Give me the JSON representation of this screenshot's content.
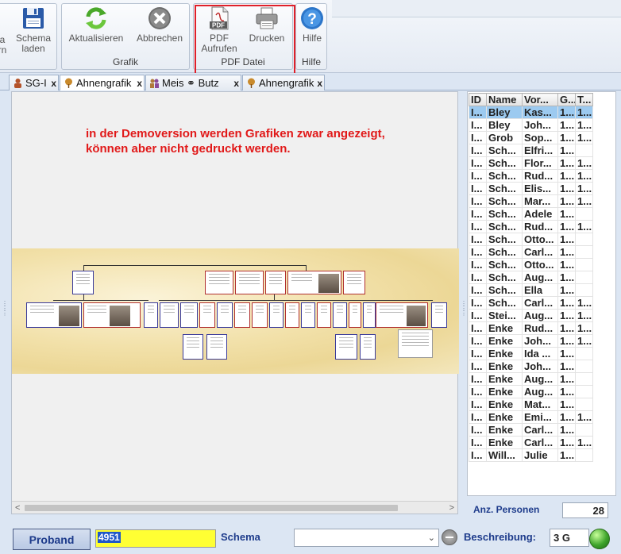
{
  "ribbon": {
    "schema_group": {
      "partial_label_top": "a",
      "partial_label_bottom": "rn",
      "schema_laden_label_1": "Schema",
      "schema_laden_label_2": "laden"
    },
    "grafik_group": {
      "label": "Grafik",
      "aktualisieren_label": "Aktualisieren",
      "abbrechen_label": "Abbrechen"
    },
    "pdf_group": {
      "label": "PDF Datei",
      "pdf_label_1": "PDF",
      "pdf_label_2": "Aufrufen",
      "drucken_label": "Drucken",
      "pdf_icon_text": "PDF"
    },
    "hilfe_group": {
      "label": "Hilfe",
      "hilfe_label": "Hilfe",
      "help_icon_text": "?"
    }
  },
  "tabs": [
    {
      "label": "SG-I",
      "close": "x",
      "icon": "person-icon"
    },
    {
      "label": "Ahnengrafik",
      "close": "x",
      "icon": "tree-icon"
    },
    {
      "label": "Meis ⚭ Butz",
      "close": "x",
      "icon": "couple-icon"
    },
    {
      "label": "Ahnengrafik",
      "close": "x",
      "icon": "tree-icon"
    }
  ],
  "canvas": {
    "demo_note_line1": "in der Demoversion werden Grafiken zwar angezeigt,",
    "demo_note_line2": "können aber nicht gedruckt werden."
  },
  "person_list": {
    "headers": [
      "ID",
      "Name",
      "Vor...",
      "G...",
      "T..."
    ],
    "rows": [
      [
        "I...",
        "Bley",
        "Kas...",
        "1...",
        "1..."
      ],
      [
        "I...",
        "Bley",
        "Joh...",
        "1...",
        "1..."
      ],
      [
        "I...",
        "Grob",
        "Sop...",
        "1...",
        "1..."
      ],
      [
        "I...",
        "Sch...",
        "Elfri...",
        "1...",
        ""
      ],
      [
        "I...",
        "Sch...",
        "Flor...",
        "1...",
        "1..."
      ],
      [
        "I...",
        "Sch...",
        "Rud...",
        "1...",
        "1..."
      ],
      [
        "I...",
        "Sch...",
        "Elis...",
        "1...",
        "1..."
      ],
      [
        "I...",
        "Sch...",
        "Mar...",
        "1...",
        "1..."
      ],
      [
        "I...",
        "Sch...",
        "Adele",
        "1...",
        ""
      ],
      [
        "I...",
        "Sch...",
        "Rud...",
        "1...",
        "1..."
      ],
      [
        "I...",
        "Sch...",
        "Otto...",
        "1...",
        ""
      ],
      [
        "I...",
        "Sch...",
        "Carl...",
        "1...",
        ""
      ],
      [
        "I...",
        "Sch...",
        "Otto...",
        "1...",
        ""
      ],
      [
        "I...",
        "Sch...",
        "Aug...",
        "1...",
        ""
      ],
      [
        "I...",
        "Sch...",
        "Ella",
        "1...",
        ""
      ],
      [
        "I...",
        "Sch...",
        "Carl...",
        "1...",
        "1..."
      ],
      [
        "I...",
        "Stei...",
        "Aug...",
        "1...",
        "1..."
      ],
      [
        "I...",
        "Enke",
        "Rud...",
        "1...",
        "1..."
      ],
      [
        "I...",
        "Enke",
        "Joh...",
        "1...",
        "1..."
      ],
      [
        "I...",
        "Enke",
        "Ida ...",
        "1...",
        ""
      ],
      [
        "I...",
        "Enke",
        "Joh...",
        "1...",
        ""
      ],
      [
        "I...",
        "Enke",
        "Aug...",
        "1...",
        ""
      ],
      [
        "I...",
        "Enke",
        "Aug...",
        "1...",
        ""
      ],
      [
        "I...",
        "Enke",
        "Mat...",
        "1...",
        ""
      ],
      [
        "I...",
        "Enke",
        "Emi...",
        "1...",
        "1..."
      ],
      [
        "I...",
        "Enke",
        "Carl...",
        "1...",
        ""
      ],
      [
        "I...",
        "Enke",
        "Carl...",
        "1...",
        "1..."
      ],
      [
        "I...",
        "Will...",
        "Julie",
        "1...",
        ""
      ]
    ],
    "selected_row": 0,
    "anz_label": "Anz. Personen",
    "anz_value": "28"
  },
  "bottom": {
    "proband_label": "Proband",
    "proband_value": "4951",
    "schema_label": "Schema",
    "schema_value": "",
    "beschreibung_label": "Beschreibung:",
    "beschreibung_value": "3 G"
  },
  "colors": {
    "accent": "#1d3b8b",
    "warning_text": "#e11919",
    "highlight_frame": "#e0202a",
    "proband_field": "#ffff33",
    "selected_row": "#9ccaf0",
    "status_light": "#3fa52c"
  }
}
